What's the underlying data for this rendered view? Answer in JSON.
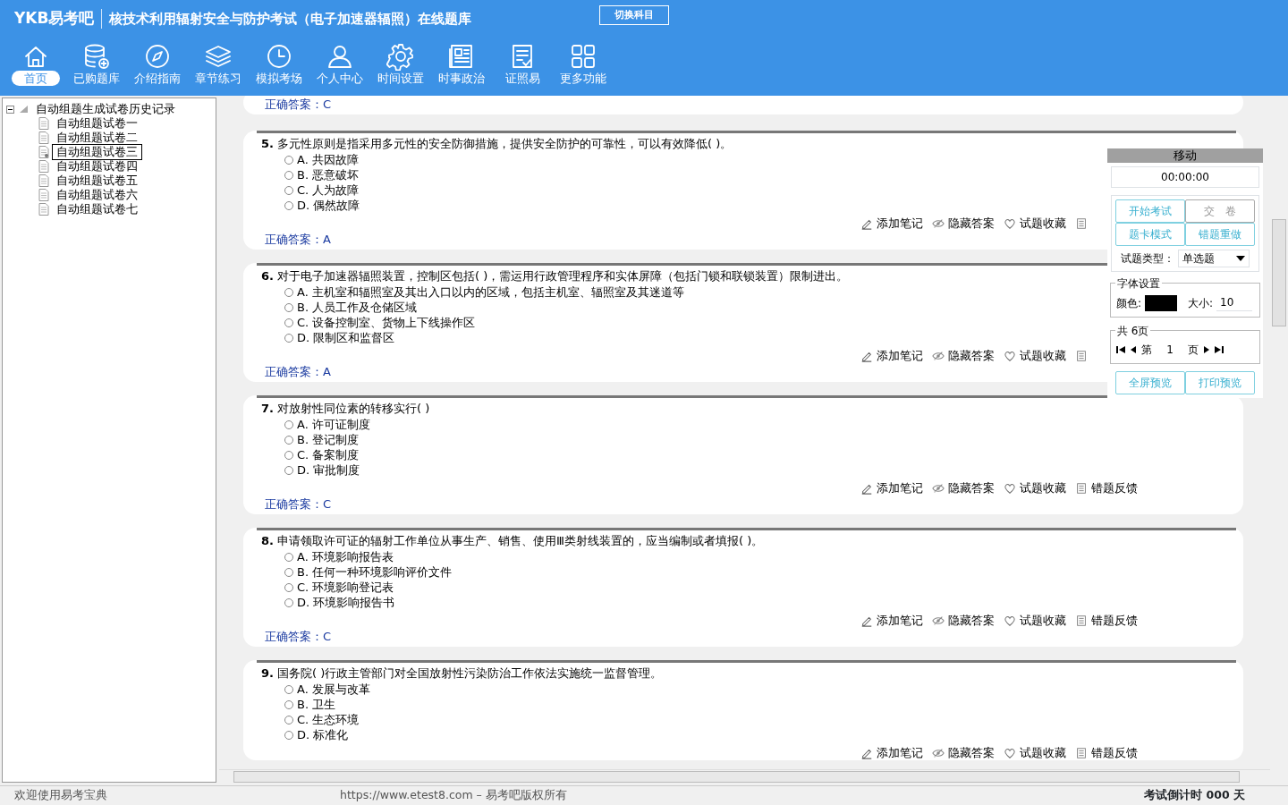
{
  "header": {
    "brand": "YKB易考吧",
    "title": "核技术利用辐射安全与防护考试（电子加速器辐照）在线题库",
    "switch_button": "切换科目"
  },
  "nav": [
    {
      "kind": "home",
      "label": "首页",
      "selected": true
    },
    {
      "kind": "database",
      "label": "已购题库",
      "selected": false
    },
    {
      "kind": "compass",
      "label": "介绍指南",
      "selected": false
    },
    {
      "kind": "layers",
      "label": "章节练习",
      "selected": false
    },
    {
      "kind": "clock",
      "label": "模拟考场",
      "selected": false
    },
    {
      "kind": "person",
      "label": "个人中心",
      "selected": false
    },
    {
      "kind": "gear",
      "label": "时间设置",
      "selected": false
    },
    {
      "kind": "news",
      "label": "时事政治",
      "selected": false
    },
    {
      "kind": "checklist",
      "label": "证照易",
      "selected": false
    },
    {
      "kind": "grid",
      "label": "更多功能",
      "selected": false
    }
  ],
  "tree": {
    "label": "自动组题生成试卷历史记录",
    "expanded": true,
    "children": [
      {
        "label": "自动组题试卷一",
        "selected": false
      },
      {
        "label": "自动组题试卷二",
        "selected": false
      },
      {
        "label": "自动组题试卷三",
        "selected": true
      },
      {
        "label": "自动组题试卷四",
        "selected": false
      },
      {
        "label": "自动组题试卷五",
        "selected": false
      },
      {
        "label": "自动组题试卷六",
        "selected": false
      },
      {
        "label": "自动组题试卷七",
        "selected": false
      }
    ]
  },
  "previous_answer": "正确答案：C",
  "questions": [
    {
      "number": "5.",
      "text": "多元性原则是指采用多元性的安全防御措施，提供安全防护的可靠性，可以有效降低( )。",
      "options": [
        {
          "label": "A. 共因故障",
          "selected": false
        },
        {
          "label": "B. 恶意破坏",
          "selected": false
        },
        {
          "label": "C. 人为故障",
          "selected": false
        },
        {
          "label": "D. 偶然故障",
          "selected": false
        }
      ],
      "answer": "正确答案：A",
      "tools": [
        {
          "kind": "note",
          "label": "添加笔记"
        },
        {
          "kind": "hide",
          "label": "隐藏答案"
        },
        {
          "kind": "favorite",
          "label": "试题收藏"
        },
        {
          "kind": "feedback"
        }
      ]
    },
    {
      "number": "6.",
      "text": "对于电子加速器辐照装置，控制区包括( )，需运用行政管理程序和实体屏障（包括门锁和联锁装置）限制进出。",
      "options": [
        {
          "label": "A. 主机室和辐照室及其出入口以内的区域，包括主机室、辐照室及其迷道等",
          "selected": false
        },
        {
          "label": "B. 人员工作及仓储区域",
          "selected": false
        },
        {
          "label": "C. 设备控制室、货物上下线操作区",
          "selected": false
        },
        {
          "label": "D. 限制区和监督区",
          "selected": false
        }
      ],
      "answer": "正确答案：A",
      "tools": [
        {
          "kind": "note",
          "label": "添加笔记"
        },
        {
          "kind": "hide",
          "label": "隐藏答案"
        },
        {
          "kind": "favorite",
          "label": "试题收藏"
        },
        {
          "kind": "feedback"
        }
      ]
    },
    {
      "number": "7.",
      "text": "对放射性同位素的转移实行( )",
      "options": [
        {
          "label": "A. 许可证制度",
          "selected": false
        },
        {
          "label": "B. 登记制度",
          "selected": false
        },
        {
          "label": "C. 备案制度",
          "selected": false
        },
        {
          "label": "D. 审批制度",
          "selected": false
        }
      ],
      "answer": "正确答案：C",
      "tools": [
        {
          "kind": "note",
          "label": "添加笔记"
        },
        {
          "kind": "hide",
          "label": "隐藏答案"
        },
        {
          "kind": "favorite",
          "label": "试题收藏"
        },
        {
          "kind": "feedback",
          "label": "错题反馈"
        }
      ]
    },
    {
      "number": "8.",
      "text": "申请领取许可证的辐射工作单位从事生产、销售、使用Ⅲ类射线装置的，应当编制或者填报( )。",
      "options": [
        {
          "label": "A. 环境影响报告表",
          "selected": false
        },
        {
          "label": "B. 任何一种环境影响评价文件",
          "selected": false
        },
        {
          "label": "C. 环境影响登记表",
          "selected": false
        },
        {
          "label": "D. 环境影响报告书",
          "selected": false
        }
      ],
      "answer": "正确答案：C",
      "tools": [
        {
          "kind": "note",
          "label": "添加笔记"
        },
        {
          "kind": "hide",
          "label": "隐藏答案"
        },
        {
          "kind": "favorite",
          "label": "试题收藏"
        },
        {
          "kind": "feedback",
          "label": "错题反馈"
        }
      ]
    },
    {
      "number": "9.",
      "text": "国务院( )行政主管部门对全国放射性污染防治工作依法实施统一监督管理。",
      "options": [
        {
          "label": "A. 发展与改革",
          "selected": false
        },
        {
          "label": "B. 卫生",
          "selected": false
        },
        {
          "label": "C. 生态环境",
          "selected": false
        },
        {
          "label": "D. 标准化",
          "selected": false
        }
      ],
      "tools": [
        {
          "kind": "note",
          "label": "添加笔记"
        },
        {
          "kind": "hide",
          "label": "隐藏答案"
        },
        {
          "kind": "favorite",
          "label": "试题收藏"
        },
        {
          "kind": "feedback",
          "label": "错题反馈"
        }
      ]
    }
  ],
  "panel": {
    "title": "移动",
    "timer": "00:00:00",
    "buttons": [
      {
        "label": "开始考试",
        "disabled": false
      },
      {
        "label": "交　卷",
        "disabled": true
      },
      {
        "label": "题卡模式",
        "disabled": false
      },
      {
        "label": "错题重做",
        "disabled": false
      }
    ],
    "type_label": "试题类型：",
    "type_value": "单选题",
    "font_legend": "字体设置",
    "color_label": "颜色:",
    "size_label": "大小:",
    "size_value": "10",
    "pages_legend": "共 6页",
    "page_prefix": "第",
    "page_value": "1",
    "page_suffix": "页",
    "bottom_buttons": [
      "全屏预览",
      "打印预览"
    ]
  },
  "status_bar": {
    "welcome": "欢迎使用易考宝典",
    "copyright": "https://www.etest8.com – 易考吧版权所有",
    "countdown": "考试倒计时 000 天"
  }
}
